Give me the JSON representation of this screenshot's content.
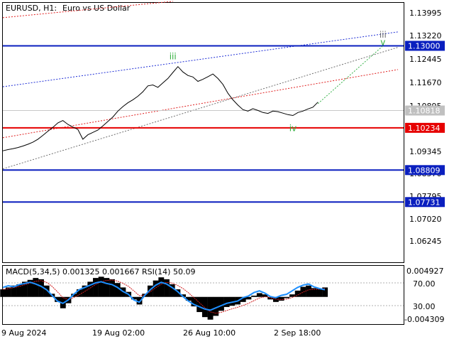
{
  "header": {
    "symbol_timeframe": "EURUSD, H1:",
    "description": "Euro vs US Dollar"
  },
  "colors": {
    "price_line": "#000000",
    "axis_text": "#000000",
    "frame": "#000000",
    "grid": "#c8c8c8",
    "horizontal_blue": "#0a1fbf",
    "horizontal_red": "#e60000",
    "label_blue_bg": "#0a1fbf",
    "label_red_bg": "#e60000",
    "label_current_bg": "#c0c0c0",
    "label_text_on_color": "#ffffff",
    "trend_blue_dotted": "#1f2fd6",
    "trend_red_dotted": "#e02020",
    "trend_gray_dotted": "#707070",
    "trend_green_dotted": "#37b34a",
    "wave_label": "#2fae3a",
    "wave_label_gray": "#707070",
    "macd_hist": "#000000",
    "macd_signal": "#d02020",
    "rsi_line": "#1e8fff",
    "level_lines": "#b0b0b0"
  },
  "chart_data": [
    {
      "type": "line",
      "title": "EURUSD, H1:  Euro vs US Dollar",
      "x_ticks": [
        "9 Aug 2024",
        "19 Aug 02:00",
        "26 Aug 10:00",
        "2 Sep 18:00"
      ],
      "y_ticks": [
        "1.13995",
        "1.13220",
        "1.12445",
        "1.11670",
        "1.10895",
        "1.10120",
        "1.09345",
        "1.08570",
        "1.07795",
        "1.07020",
        "1.06245"
      ],
      "ylim": [
        1.057,
        1.1445
      ],
      "series": [
        {
          "values": [
            1.0946,
            1.095,
            1.0953,
            1.0957,
            1.0962,
            1.0968,
            1.0975,
            1.0985,
            1.0998,
            1.1012,
            1.1025,
            1.104,
            1.1048,
            1.1035,
            1.1026,
            1.1018,
            1.0985,
            1.1,
            1.1008,
            1.1016,
            1.103,
            1.1045,
            1.106,
            1.108,
            1.1095,
            1.1108,
            1.1118,
            1.113,
            1.1145,
            1.1165,
            1.1168,
            1.116,
            1.1175,
            1.119,
            1.121,
            1.123,
            1.1212,
            1.12,
            1.1195,
            1.118,
            1.1187,
            1.1196,
            1.1205,
            1.119,
            1.117,
            1.114,
            1.1118,
            1.11,
            1.1085,
            1.108,
            1.1088,
            1.1082,
            1.1075,
            1.1072,
            1.108,
            1.1078,
            1.1073,
            1.1068,
            1.1065,
            1.1075,
            1.108,
            1.1087,
            1.1093,
            1.111
          ]
        }
      ],
      "horizontal_levels": [
        {
          "value": 1.13,
          "label": "1.13000",
          "color": "blue"
        },
        {
          "value": 1.10234,
          "label": "1.10234",
          "color": "red"
        },
        {
          "value": 1.08809,
          "label": "1.08809",
          "color": "blue"
        },
        {
          "value": 1.07731,
          "label": "1.07731",
          "color": "blue"
        }
      ],
      "current_price": {
        "value": 1.10818,
        "label": "1.10818"
      },
      "wave_labels": [
        {
          "text": "iii",
          "x_index": 34,
          "value": 1.1255
        },
        {
          "text": "iv",
          "x_index": 58,
          "value": 1.1012
        },
        {
          "text": "v",
          "x_index": 76,
          "value": 1.1302
        },
        {
          "text": "iii",
          "x_index": 76,
          "value": 1.1328
        }
      ],
      "forecast_path": {
        "from_index": 63,
        "from_value": 1.1105,
        "to_index": 76,
        "to_value": 1.13
      },
      "trend_lines": [
        {
          "style": "dotted",
          "color": "blue",
          "from": [
            0,
            1.1162
          ],
          "to": [
            79,
            1.1347
          ]
        },
        {
          "style": "dotted",
          "color": "red",
          "from": [
            0,
            1.099
          ],
          "to": [
            79,
            1.122
          ]
        },
        {
          "style": "dotted",
          "color": "gray",
          "from": [
            0,
            1.0885
          ],
          "to": [
            79,
            1.1295
          ]
        },
        {
          "style": "dotted",
          "color": "red",
          "from": [
            0,
            1.1395
          ],
          "to": [
            34,
            1.145
          ]
        }
      ],
      "x_count": 80
    },
    {
      "type": "line",
      "title": "MACD(5,34,5) 0.001325 0.001667 RSI(14) 50.09",
      "y_ticks": [
        "0.004927",
        "70.00",
        "30.00",
        "-0.004309"
      ],
      "ylim": [
        -0.004309,
        0.004927
      ],
      "series": [
        {
          "name": "MACD",
          "values": [
            0.0012,
            0.0015,
            0.0018,
            0.002,
            0.0024,
            0.0027,
            0.003,
            0.0028,
            0.0018,
            0.0005,
            -0.0008,
            -0.0018,
            -0.001,
            0.0005,
            0.0012,
            0.0018,
            0.0024,
            0.003,
            0.0032,
            0.003,
            0.0028,
            0.0022,
            0.0015,
            0.0008,
            -0.0004,
            -0.0012,
            0.0005,
            0.0018,
            0.0026,
            0.0031,
            0.0028,
            0.002,
            0.0012,
            0.0004,
            -0.0006,
            -0.0015,
            -0.0024,
            -0.0032,
            -0.0036,
            -0.003,
            -0.0022,
            -0.0016,
            -0.0014,
            -0.0012,
            -0.0008,
            -0.0004,
            0.0002,
            0.0006,
            0.0004,
            -0.0004,
            -0.0008,
            -0.0006,
            -0.0002,
            0.0004,
            0.001,
            0.0016,
            0.0018,
            0.0014,
            0.0013,
            0.0015
          ]
        },
        {
          "name": "RSI(14)",
          "values": [
            62,
            65,
            63,
            67,
            69,
            71,
            68,
            64,
            58,
            48,
            38,
            34,
            40,
            50,
            58,
            62,
            66,
            70,
            72,
            69,
            67,
            62,
            55,
            50,
            40,
            36,
            48,
            58,
            66,
            71,
            68,
            62,
            55,
            46,
            38,
            32,
            28,
            24,
            22,
            26,
            30,
            34,
            36,
            38,
            44,
            47,
            53,
            56,
            52,
            46,
            44,
            48,
            50,
            56,
            62,
            66,
            68,
            63,
            60,
            58
          ]
        }
      ]
    }
  ]
}
